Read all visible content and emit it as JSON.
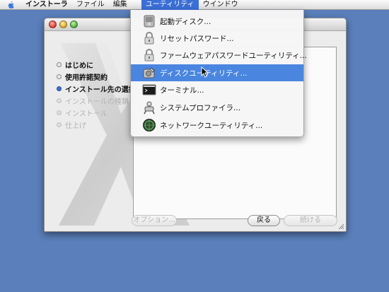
{
  "menubar": {
    "items": [
      {
        "label": "インストーラ"
      },
      {
        "label": "ファイル"
      },
      {
        "label": "編集"
      },
      {
        "label": "ユーティリティ"
      },
      {
        "label": "ウインドウ"
      }
    ]
  },
  "window": {
    "steps": [
      {
        "label": "はじめに"
      },
      {
        "label": "使用許諾契約"
      },
      {
        "label": "インストール先の選択"
      },
      {
        "label": "インストールの種類"
      },
      {
        "label": "インストール"
      },
      {
        "label": "仕上げ"
      }
    ],
    "buttons": {
      "options": "オプション...",
      "back": "戻る",
      "continue": "続ける"
    }
  },
  "utilities_menu": {
    "items": [
      {
        "label": "起動ディスク...",
        "icon": "startup-disk-icon"
      },
      {
        "label": "リセットパスワード...",
        "icon": "lock-icon"
      },
      {
        "label": "ファームウェアパスワードユーティリティ...",
        "icon": "lock-icon"
      },
      {
        "label": "ディスクユーティリティ...",
        "icon": "disk-utility-icon",
        "selected": true
      },
      {
        "label": "ターミナル...",
        "icon": "terminal-icon"
      },
      {
        "label": "システムプロファイラ...",
        "icon": "system-profiler-icon"
      },
      {
        "label": "ネットワークユーティリティ...",
        "icon": "network-utility-icon"
      }
    ]
  },
  "colors": {
    "desktop": "#5a7fba",
    "menu_highlight": "#3a6fd6",
    "menu_selected": "#4a86e0"
  }
}
